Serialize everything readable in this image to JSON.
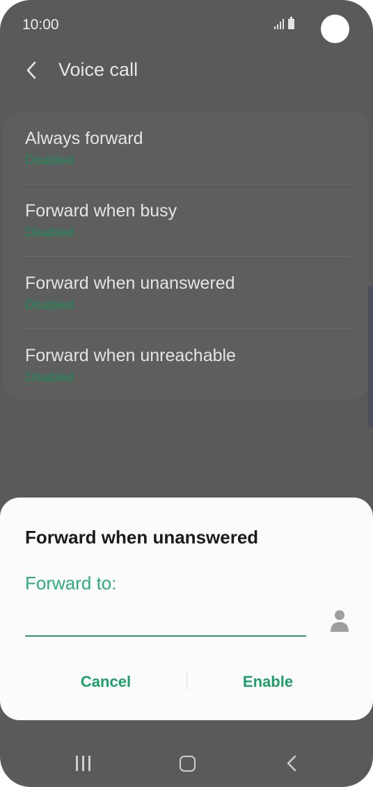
{
  "status_bar": {
    "time": "10:00"
  },
  "header": {
    "title": "Voice call"
  },
  "forwarding_options": [
    {
      "title": "Always forward",
      "status": "Disabled"
    },
    {
      "title": "Forward when busy",
      "status": "Disabled"
    },
    {
      "title": "Forward when unanswered",
      "status": "Disabled"
    },
    {
      "title": "Forward when unreachable",
      "status": "Disabled"
    }
  ],
  "dialog": {
    "title": "Forward when unanswered",
    "field_label": "Forward to:",
    "field_value": "",
    "cancel_label": "Cancel",
    "enable_label": "Enable"
  },
  "icons": {
    "back": "back-arrow-icon",
    "contact": "contact-person-icon",
    "signal": "signal-icon",
    "battery": "battery-icon"
  },
  "colors": {
    "accent": "#1f9e6a",
    "status_disabled": "#1e8a5a",
    "dim_background": "#5a5a5a",
    "dialog_background": "#fbfbfb"
  }
}
